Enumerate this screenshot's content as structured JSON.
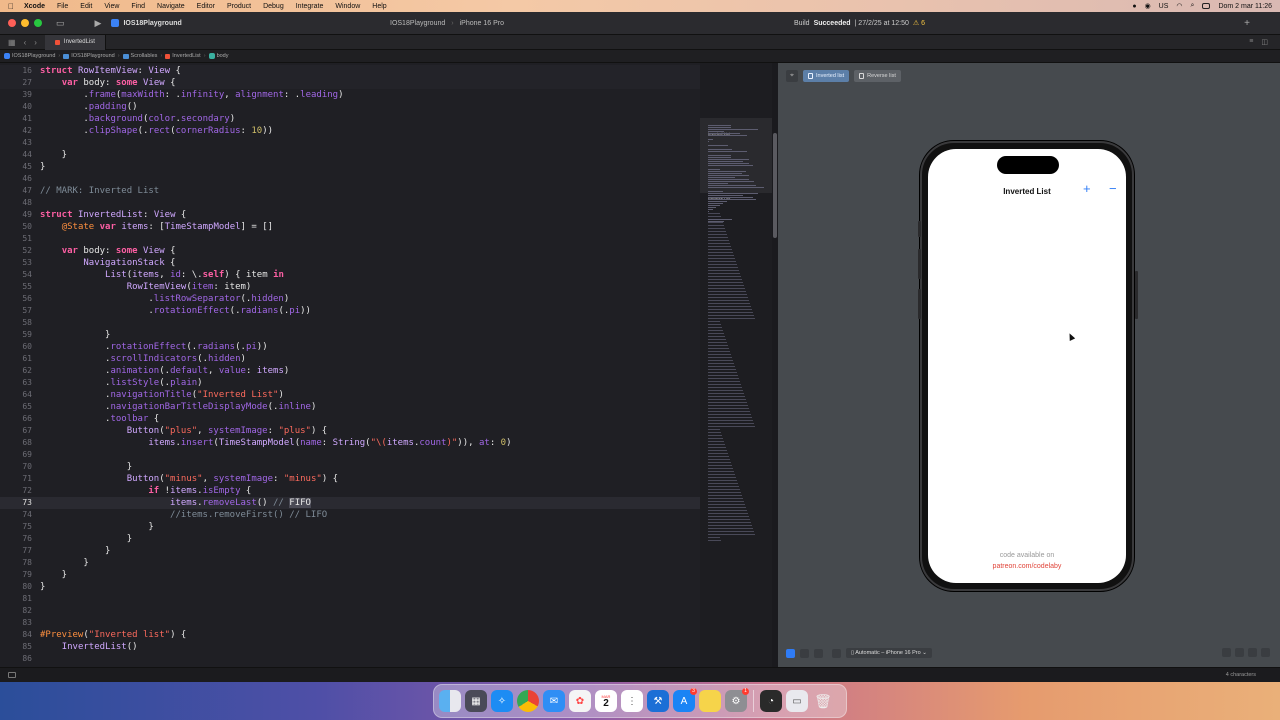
{
  "menubar": {
    "apple": "",
    "items": [
      "Xcode",
      "File",
      "Edit",
      "View",
      "Find",
      "Navigate",
      "Editor",
      "Product",
      "Debug",
      "Integrate",
      "Window",
      "Help"
    ],
    "keyboard": "US",
    "clock": "Dom 2 mar  11:26"
  },
  "toolbar": {
    "project": "IOS18Playground",
    "scheme": "IOS18Playground",
    "device": "iPhone 16 Pro",
    "build_result": "Succeeded",
    "build_prefix": "Build",
    "build_time": "| 27/2/25 at 12:50",
    "warnings": "⚠ 6"
  },
  "tabbar": {
    "active_tab": "InvertedList"
  },
  "jumpbar": {
    "crumbs": [
      "IOS18Playground",
      "IOS18Playground",
      "Scrollables",
      "InvertedList",
      "body"
    ]
  },
  "editor": {
    "lines": [
      {
        "n": "16",
        "code": [
          [
            "kw",
            "struct "
          ],
          [
            "ty",
            "RowItemView"
          ],
          [
            "pl",
            ": "
          ],
          [
            "ty",
            "View"
          ],
          [
            "pl",
            " {"
          ]
        ],
        "sticky": true
      },
      {
        "n": "27",
        "code": [
          [
            "pl",
            "    "
          ],
          [
            "kw",
            "var "
          ],
          [
            "pl",
            "body: "
          ],
          [
            "kw",
            "some "
          ],
          [
            "ty",
            "View"
          ],
          [
            "pl",
            " {"
          ]
        ],
        "sticky": true
      },
      {
        "n": "39",
        "code": [
          [
            "pl",
            "        ."
          ],
          [
            "fn",
            "frame"
          ],
          [
            "pl",
            "("
          ],
          [
            "fn",
            "maxWidth"
          ],
          [
            "pl",
            ": ."
          ],
          [
            "fn",
            "infinity"
          ],
          [
            "pl",
            ", "
          ],
          [
            "fn",
            "alignment"
          ],
          [
            "pl",
            ": ."
          ],
          [
            "fn",
            "leading"
          ],
          [
            "pl",
            ")"
          ]
        ]
      },
      {
        "n": "40",
        "code": [
          [
            "pl",
            "        ."
          ],
          [
            "fn",
            "padding"
          ],
          [
            "pl",
            "()"
          ]
        ]
      },
      {
        "n": "41",
        "code": [
          [
            "pl",
            "        ."
          ],
          [
            "fn",
            "background"
          ],
          [
            "pl",
            "("
          ],
          [
            "fn",
            "color"
          ],
          [
            "pl",
            "."
          ],
          [
            "fn",
            "secondary"
          ],
          [
            "pl",
            ")"
          ]
        ]
      },
      {
        "n": "42",
        "code": [
          [
            "pl",
            "        ."
          ],
          [
            "fn",
            "clipShape"
          ],
          [
            "pl",
            "(."
          ],
          [
            "fn",
            "rect"
          ],
          [
            "pl",
            "("
          ],
          [
            "fn",
            "cornerRadius"
          ],
          [
            "pl",
            ": "
          ],
          [
            "num",
            "10"
          ],
          [
            "pl",
            "))"
          ]
        ]
      },
      {
        "n": "43",
        "code": []
      },
      {
        "n": "44",
        "code": [
          [
            "pl",
            "    }"
          ]
        ]
      },
      {
        "n": "45",
        "code": [
          [
            "pl",
            "}"
          ]
        ]
      },
      {
        "n": "46",
        "code": []
      },
      {
        "n": "47",
        "code": [
          [
            "cm",
            "// MARK: Inverted List"
          ]
        ]
      },
      {
        "n": "48",
        "code": []
      },
      {
        "n": "49",
        "code": [
          [
            "kw",
            "struct "
          ],
          [
            "ty",
            "InvertedList"
          ],
          [
            "pl",
            ": "
          ],
          [
            "ty",
            "View"
          ],
          [
            "pl",
            " {"
          ]
        ]
      },
      {
        "n": "50",
        "code": [
          [
            "pl",
            "    "
          ],
          [
            "at",
            "@State "
          ],
          [
            "kw",
            "var "
          ],
          [
            "ty",
            "items"
          ],
          [
            "pl",
            ": ["
          ],
          [
            "ty",
            "TimeStampModel"
          ],
          [
            "pl",
            "] = []"
          ]
        ]
      },
      {
        "n": "51",
        "code": []
      },
      {
        "n": "52",
        "code": [
          [
            "pl",
            "    "
          ],
          [
            "kw",
            "var "
          ],
          [
            "pl",
            "body: "
          ],
          [
            "kw",
            "some "
          ],
          [
            "ty",
            "View"
          ],
          [
            "pl",
            " {"
          ]
        ]
      },
      {
        "n": "53",
        "code": [
          [
            "pl",
            "        "
          ],
          [
            "ty",
            "NavigationStack"
          ],
          [
            "pl",
            " {"
          ]
        ]
      },
      {
        "n": "54",
        "code": [
          [
            "pl",
            "            "
          ],
          [
            "ty",
            "List"
          ],
          [
            "pl",
            "("
          ],
          [
            "ty",
            "items"
          ],
          [
            "pl",
            ", "
          ],
          [
            "fn",
            "id"
          ],
          [
            "pl",
            ": \\."
          ],
          [
            "kw",
            "self"
          ],
          [
            "pl",
            ") { item "
          ],
          [
            "kw",
            "in"
          ]
        ]
      },
      {
        "n": "55",
        "code": [
          [
            "pl",
            "                "
          ],
          [
            "ty",
            "RowItemView"
          ],
          [
            "pl",
            "("
          ],
          [
            "fn",
            "item"
          ],
          [
            "pl",
            ": item)"
          ]
        ]
      },
      {
        "n": "56",
        "code": [
          [
            "pl",
            "                    ."
          ],
          [
            "fn",
            "listRowSeparator"
          ],
          [
            "pl",
            "(."
          ],
          [
            "fn",
            "hidden"
          ],
          [
            "pl",
            ")"
          ]
        ]
      },
      {
        "n": "57",
        "code": [
          [
            "pl",
            "                    ."
          ],
          [
            "fn",
            "rotationEffect"
          ],
          [
            "pl",
            "(."
          ],
          [
            "fn",
            "radians"
          ],
          [
            "pl",
            "(."
          ],
          [
            "fn",
            "pi"
          ],
          [
            "pl",
            "))"
          ]
        ]
      },
      {
        "n": "58",
        "code": []
      },
      {
        "n": "59",
        "code": [
          [
            "pl",
            "            }"
          ]
        ]
      },
      {
        "n": "60",
        "code": [
          [
            "pl",
            "            ."
          ],
          [
            "fn",
            "rotationEffect"
          ],
          [
            "pl",
            "(."
          ],
          [
            "fn",
            "radians"
          ],
          [
            "pl",
            "(."
          ],
          [
            "fn",
            "pi"
          ],
          [
            "pl",
            "))"
          ]
        ]
      },
      {
        "n": "61",
        "code": [
          [
            "pl",
            "            ."
          ],
          [
            "fn",
            "scrollIndicators"
          ],
          [
            "pl",
            "(."
          ],
          [
            "fn",
            "hidden"
          ],
          [
            "pl",
            ")"
          ]
        ]
      },
      {
        "n": "62",
        "code": [
          [
            "pl",
            "            ."
          ],
          [
            "fn",
            "animation"
          ],
          [
            "pl",
            "(."
          ],
          [
            "fn",
            "default"
          ],
          [
            "pl",
            ", "
          ],
          [
            "fn",
            "value"
          ],
          [
            "pl",
            ": "
          ],
          [
            "ty",
            "items"
          ],
          [
            "pl",
            ")"
          ]
        ]
      },
      {
        "n": "63",
        "code": [
          [
            "pl",
            "            ."
          ],
          [
            "fn",
            "listStyle"
          ],
          [
            "pl",
            "(."
          ],
          [
            "fn",
            "plain"
          ],
          [
            "pl",
            ")"
          ]
        ]
      },
      {
        "n": "64",
        "code": [
          [
            "pl",
            "            ."
          ],
          [
            "fn",
            "navigationTitle"
          ],
          [
            "pl",
            "("
          ],
          [
            "str",
            "\"Inverted List\""
          ],
          [
            "pl",
            ")"
          ]
        ]
      },
      {
        "n": "65",
        "code": [
          [
            "pl",
            "            ."
          ],
          [
            "fn",
            "navigationBarTitleDisplayMode"
          ],
          [
            "pl",
            "(."
          ],
          [
            "fn",
            "inline"
          ],
          [
            "pl",
            ")"
          ]
        ]
      },
      {
        "n": "66",
        "code": [
          [
            "pl",
            "            ."
          ],
          [
            "fn",
            "toolbar"
          ],
          [
            "pl",
            " {"
          ]
        ]
      },
      {
        "n": "67",
        "code": [
          [
            "pl",
            "                "
          ],
          [
            "ty",
            "Button"
          ],
          [
            "pl",
            "("
          ],
          [
            "str",
            "\"plus\""
          ],
          [
            "pl",
            ", "
          ],
          [
            "fn",
            "systemImage"
          ],
          [
            "pl",
            ": "
          ],
          [
            "str",
            "\"plus\""
          ],
          [
            "pl",
            ") {"
          ]
        ]
      },
      {
        "n": "68",
        "code": [
          [
            "pl",
            "                    "
          ],
          [
            "ty",
            "items"
          ],
          [
            "pl",
            "."
          ],
          [
            "fn",
            "insert"
          ],
          [
            "pl",
            "("
          ],
          [
            "ty",
            "TimeStampModel"
          ],
          [
            "pl",
            "("
          ],
          [
            "fn",
            "name"
          ],
          [
            "pl",
            ": "
          ],
          [
            "ty",
            "String"
          ],
          [
            "pl",
            "("
          ],
          [
            "str",
            "\"\\("
          ],
          [
            "ty",
            "items"
          ],
          [
            "pl",
            "."
          ],
          [
            "fn",
            "count"
          ],
          [
            "str",
            ")\""
          ],
          [
            "pl",
            ")), "
          ],
          [
            "fn",
            "at"
          ],
          [
            "pl",
            ": "
          ],
          [
            "num",
            "0"
          ],
          [
            "pl",
            ")"
          ]
        ]
      },
      {
        "n": "69",
        "code": []
      },
      {
        "n": "70",
        "code": [
          [
            "pl",
            "                }"
          ]
        ]
      },
      {
        "n": "71",
        "code": [
          [
            "pl",
            "                "
          ],
          [
            "ty",
            "Button"
          ],
          [
            "pl",
            "("
          ],
          [
            "str",
            "\"minus\""
          ],
          [
            "pl",
            ", "
          ],
          [
            "fn",
            "systemImage"
          ],
          [
            "pl",
            ": "
          ],
          [
            "str",
            "\"minus\""
          ],
          [
            "pl",
            ") {"
          ]
        ]
      },
      {
        "n": "72",
        "code": [
          [
            "pl",
            "                    "
          ],
          [
            "kw",
            "if "
          ],
          [
            "pl",
            "!"
          ],
          [
            "ty",
            "items"
          ],
          [
            "pl",
            "."
          ],
          [
            "fn",
            "isEmpty"
          ],
          [
            "pl",
            " {"
          ]
        ]
      },
      {
        "n": "73",
        "code": [
          [
            "pl",
            "                        "
          ],
          [
            "ty",
            "items"
          ],
          [
            "pl",
            "."
          ],
          [
            "fn",
            "removeLast"
          ],
          [
            "pl",
            "() "
          ],
          [
            "cm",
            "// "
          ],
          [
            "hl",
            "FIFO"
          ]
        ],
        "current": true
      },
      {
        "n": "74",
        "code": [
          [
            "pl",
            "                        "
          ],
          [
            "cm",
            "//items.removeFirst() // LIFO"
          ]
        ]
      },
      {
        "n": "75",
        "code": [
          [
            "pl",
            "                    }"
          ]
        ]
      },
      {
        "n": "76",
        "code": [
          [
            "pl",
            "                }"
          ]
        ]
      },
      {
        "n": "77",
        "code": [
          [
            "pl",
            "            }"
          ]
        ]
      },
      {
        "n": "78",
        "code": [
          [
            "pl",
            "        }"
          ]
        ]
      },
      {
        "n": "79",
        "code": [
          [
            "pl",
            "    }"
          ]
        ]
      },
      {
        "n": "80",
        "code": [
          [
            "pl",
            "}"
          ]
        ]
      },
      {
        "n": "81",
        "code": []
      },
      {
        "n": "82",
        "code": []
      },
      {
        "n": "83",
        "code": []
      },
      {
        "n": "84",
        "code": [
          [
            "at",
            "#Preview"
          ],
          [
            "pl",
            "("
          ],
          [
            "str",
            "\"Inverted list\""
          ],
          [
            "pl",
            ") {"
          ]
        ]
      },
      {
        "n": "85",
        "code": [
          [
            "pl",
            "    "
          ],
          [
            "ty",
            "InvertedList"
          ],
          [
            "pl",
            "()"
          ]
        ]
      },
      {
        "n": "86",
        "code": []
      }
    ]
  },
  "minimap": {
    "labels": [
      "Inverted List",
      "Reverse List"
    ]
  },
  "canvas": {
    "pin": "📌",
    "tabs": [
      {
        "label": "Inverted list",
        "active": true
      },
      {
        "label": "Reverse list",
        "active": false
      }
    ],
    "device_picker": "▯ Automatic – iPhone 16 Pro ⌄"
  },
  "phone": {
    "nav_title": "Inverted List",
    "plus": "+",
    "minus": "−",
    "footer_line1": "code available on",
    "footer_line2": "patreon.com/codelaby"
  },
  "statusbar": {
    "chars": "4 characters"
  },
  "dock": {
    "badges": {
      "appstore": "3",
      "settings": "1"
    },
    "calendar": {
      "month": "MAR",
      "day": "2"
    }
  },
  "colors": {
    "accent": "#2f7cf6",
    "link": "#e0453a"
  }
}
